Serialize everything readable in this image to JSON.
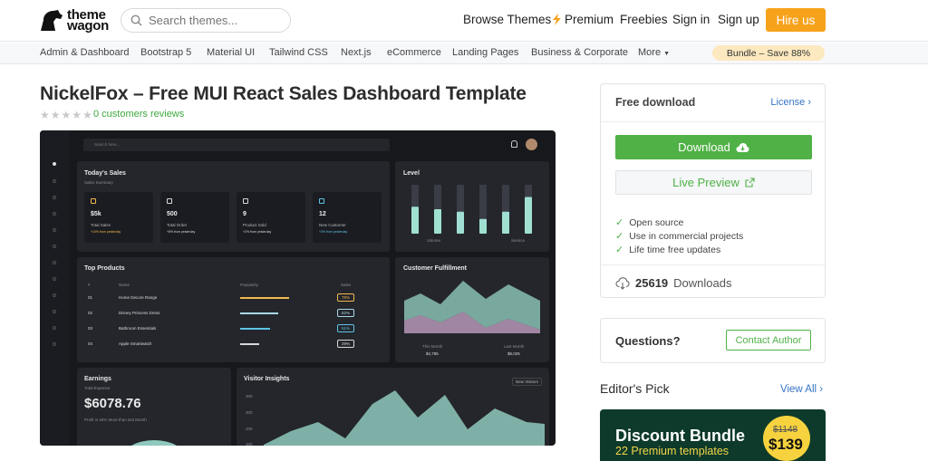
{
  "header": {
    "logo_line1": "theme",
    "logo_line2": "wagon",
    "search_placeholder": "Search themes...",
    "nav": [
      "Browse Themes",
      "Premium",
      "Freebies",
      "Sign in",
      "Sign up"
    ],
    "hire": "Hire us"
  },
  "categories": [
    "Admin & Dashboard",
    "Bootstrap 5",
    "Material UI",
    "Tailwind CSS",
    "Next.js",
    "eCommerce",
    "Landing Pages",
    "Business & Corporate",
    "More"
  ],
  "bundle_pill": "Bundle – Save 88%",
  "product": {
    "title": "NickelFox – Free MUI React Sales Dashboard Template",
    "reviews": "0 customers reviews",
    "rating": 0
  },
  "preview": {
    "search": "Search here...",
    "todays_sales": "Today's Sales",
    "sales_summary": "Sales Summary",
    "kpis": [
      {
        "value": "$5k",
        "label": "Total Sales",
        "note": "+10% from yesterday",
        "color": "#f2b84b"
      },
      {
        "value": "500",
        "label": "Total Order",
        "note": "+8% from yesterday",
        "color": "#d8d8d8"
      },
      {
        "value": "9",
        "label": "Product Sold",
        "note": "+2% from yesterday",
        "color": "#d8d8d8"
      },
      {
        "value": "12",
        "label": "New Customer",
        "note": "+3% from yesterday",
        "color": "#5cc3e6"
      }
    ],
    "level": "Level",
    "level_legend": [
      "Volume",
      "Service"
    ],
    "top_products": "Top Products",
    "tp_cols": [
      "#",
      "Name",
      "Popularity",
      "Sales"
    ],
    "tp_rows": [
      {
        "n": "01",
        "name": "Home Decore Range",
        "pop": 0.9,
        "sales": "78%",
        "color": "#f2b84b"
      },
      {
        "n": "02",
        "name": "Disney Princess Dress",
        "pop": 0.7,
        "sales": "62%",
        "color": "#a8d8e6"
      },
      {
        "n": "03",
        "name": "Bathroom Essentials",
        "pop": 0.55,
        "sales": "51%",
        "color": "#5cc3e6"
      },
      {
        "n": "04",
        "name": "Apple Smartwatch",
        "pop": 0.35,
        "sales": "29%",
        "color": "#d8d8d8"
      }
    ],
    "customer_fulfillment": "Customer Fulfillment",
    "cf_legend": [
      {
        "label": "This Month",
        "value": "$4,785"
      },
      {
        "label": "Last Month",
        "value": "$6,025"
      }
    ],
    "earnings": "Earnings",
    "total_expense": "Total Expense",
    "earn_value": "$6078.76",
    "earn_note": "Profit is 48% More than last Month",
    "visitor_insights": "Visitor Insights",
    "vi_tag": "New Visitors",
    "vi_ticks": [
      "400",
      "300",
      "200",
      "100"
    ]
  },
  "sidebar": {
    "free_download": "Free download",
    "license": "License",
    "download": "Download",
    "live_preview": "Live Preview",
    "features": [
      "Open source",
      "Use in commercial projects",
      "Life time free updates"
    ],
    "downloads_count": "25619",
    "downloads_label": "Downloads",
    "questions": "Questions?",
    "contact": "Contact Author",
    "editors_pick": "Editor's Pick",
    "view_all": "View All",
    "promo_title": "Discount Bundle",
    "promo_sub": "22 Premium templates",
    "promo_old": "$1148",
    "promo_new": "$139"
  }
}
